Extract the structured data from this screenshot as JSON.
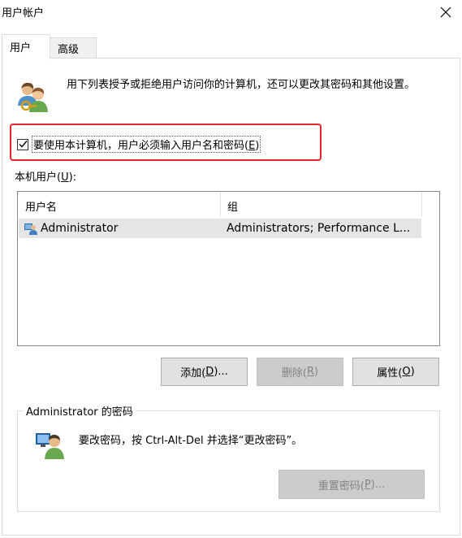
{
  "window": {
    "title": "用户帐户"
  },
  "tabs": [
    {
      "label": "用户"
    },
    {
      "label": "高级"
    }
  ],
  "intro": {
    "text": "用下列表授予或拒绝用户访问你的计算机，还可以更改其密码和其他设置。"
  },
  "require_login": {
    "checked": true,
    "label_main": "要使用本计算机，用户必须输入用户名和密码(",
    "label_key": "E",
    "label_end": ")"
  },
  "local_users": {
    "label_main": "本机用户(",
    "label_key": "U",
    "label_end": "):"
  },
  "table": {
    "columns": [
      "用户名",
      "组"
    ],
    "rows": [
      {
        "name": "Administrator",
        "group": "Administrators; Performance L..."
      }
    ]
  },
  "buttons": {
    "add": {
      "main": "添加(",
      "key": "D",
      "end": ")..."
    },
    "remove": {
      "main": "删除(",
      "key": "R",
      "end": ")"
    },
    "properties": {
      "main": "属性(",
      "key": "O",
      "end": ")"
    }
  },
  "password_group": {
    "title": "Administrator 的密码",
    "text": "要改密码，按 Ctrl-Alt-Del 并选择“更改密码”。",
    "reset": {
      "main": "重置密码(",
      "key": "P",
      "end": ")..."
    }
  },
  "colors": {
    "highlight": "#e8262a",
    "selected_row": "#e5e5e5",
    "disabled_text": "#838383"
  }
}
